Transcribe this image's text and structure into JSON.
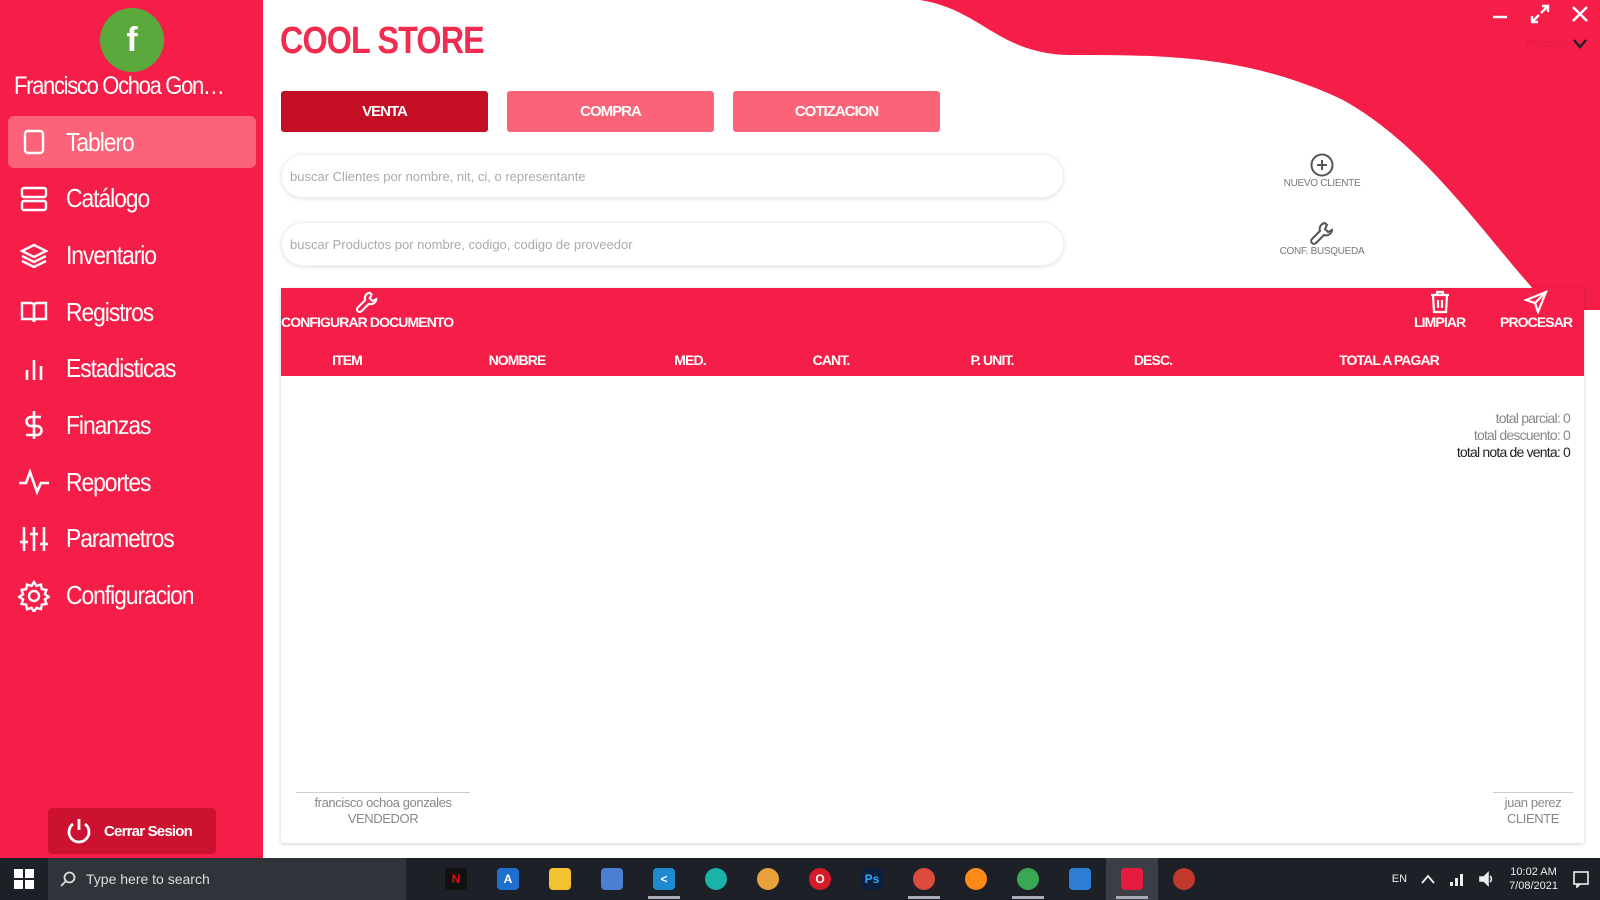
{
  "user": {
    "avatar_letter": "f",
    "name": "Francisco Ochoa Gonzal..."
  },
  "sidebar": {
    "items": [
      {
        "label": "Tablero",
        "icon": "tablet-icon",
        "active": true
      },
      {
        "label": "Catálogo",
        "icon": "server-icon",
        "active": false
      },
      {
        "label": "Inventario",
        "icon": "layers-icon",
        "active": false
      },
      {
        "label": "Registros",
        "icon": "book-icon",
        "active": false
      },
      {
        "label": "Estadisticas",
        "icon": "bar-chart-icon",
        "active": false
      },
      {
        "label": "Finanzas",
        "icon": "dollar-icon",
        "active": false
      },
      {
        "label": "Reportes",
        "icon": "activity-icon",
        "active": false
      },
      {
        "label": "Parametros",
        "icon": "sliders-icon",
        "active": false
      },
      {
        "label": "Configuracion",
        "icon": "settings-icon",
        "active": false
      }
    ],
    "logout_label": "Cerrar Sesion"
  },
  "header": {
    "title": "COOL STORE",
    "principal_label": "Principal",
    "tabs": [
      {
        "label": "VENTA",
        "active": true
      },
      {
        "label": "COMPRA",
        "active": false
      },
      {
        "label": "COTIZACION",
        "active": false
      }
    ]
  },
  "search": {
    "clients_placeholder": "buscar Clientes por nombre, nit, ci, o representante",
    "products_placeholder": "buscar Productos por nombre, codigo, codigo de proveedor"
  },
  "actions": {
    "new_client": "NUEVO CLIENTE",
    "search_config": "CONF. BUSQUEDA"
  },
  "document": {
    "configure": "CONFIGURAR DOCUMENTO",
    "clear": "LIMPIAR",
    "process": "PROCESAR",
    "columns": [
      "ITEM",
      "NOMBRE",
      "MED.",
      "CANT.",
      "P. UNIT.",
      "DESC.",
      "TOTAL A PAGAR"
    ],
    "totals": {
      "partial": "total parcial: 0",
      "discount": "total descuento: 0",
      "note": "total nota de venta: 0"
    },
    "seller": {
      "name": "francisco ochoa gonzales",
      "role": "VENDEDOR"
    },
    "client": {
      "name": "juan perez",
      "role": "CLIENTE"
    }
  },
  "taskbar": {
    "search_placeholder": "Type here to search",
    "language": "EN",
    "clock_time": "10:02 AM",
    "clock_date": "7/08/2021"
  },
  "colors": {
    "brand": "#f51e48",
    "brand_light": "#fb6478",
    "brand_dark": "#c30e24",
    "avatar": "#5aa83c"
  }
}
